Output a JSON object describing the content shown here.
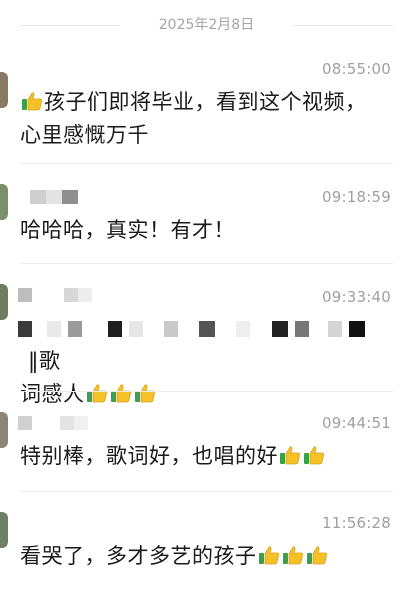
{
  "date_separator": "2025年2月8日",
  "comments": [
    {
      "time": "08:55:00",
      "text_line1": "孩子们即将毕业，看到这个视频，",
      "text_line2": "心里感慨万千",
      "thumbs_leading": 1,
      "thumbs_trailing": 0
    },
    {
      "time": "09:18:59",
      "text_line1": "哈哈哈，真实！有才！",
      "thumbs_trailing": 0
    },
    {
      "time": "09:33:40",
      "text_line1_suffix": "‖歌",
      "text_line2": "词感人",
      "thumbs_trailing": 3
    },
    {
      "time": "09:44:51",
      "text_line1": "特别棒，歌词好，也唱的好",
      "thumbs_trailing": 2
    },
    {
      "time": "11:56:28",
      "text_line1": "看哭了，多才多艺的孩子",
      "thumbs_trailing": 3
    }
  ],
  "icons": {
    "thumb": "thumbs-up-emoji",
    "avatar": "user-avatar"
  },
  "colors": {
    "thumb_yellow": "#f5c028",
    "thumb_green": "#3aa14a",
    "time_gray": "#a0a0a0",
    "divider": "#ececec"
  }
}
